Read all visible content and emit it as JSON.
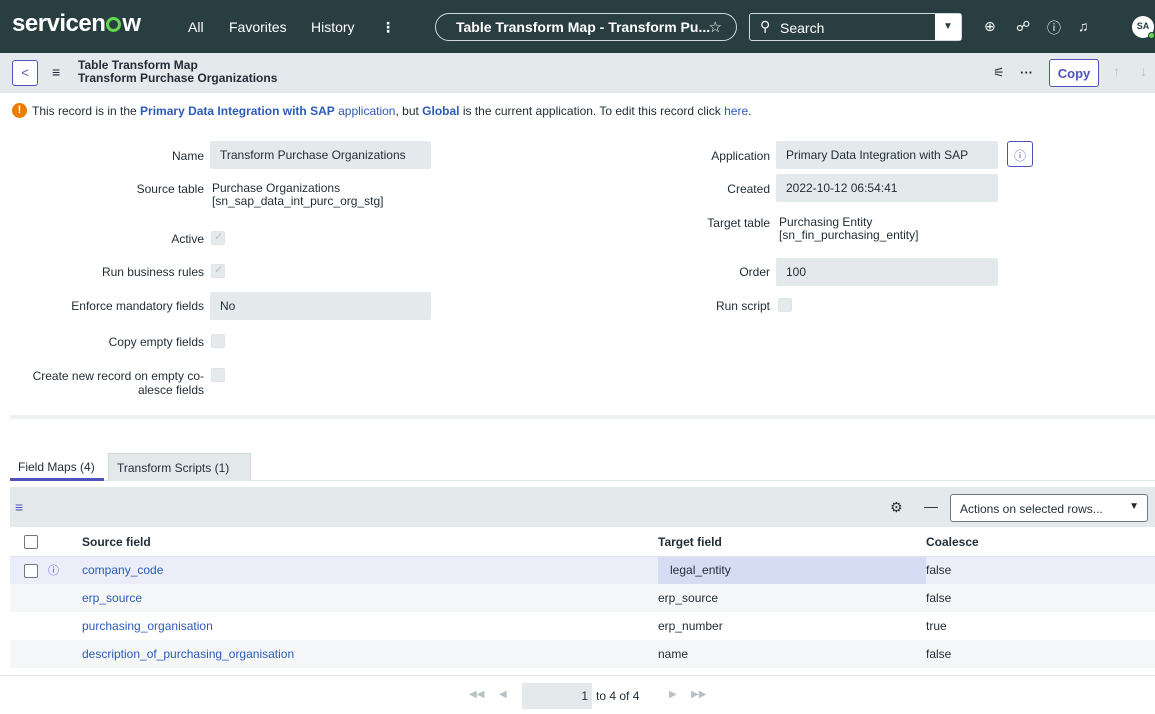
{
  "nav": {
    "logo_pre": "servicen",
    "logo_post": "w",
    "all": "All",
    "favorites": "Favorites",
    "history": "History",
    "more": "⋮",
    "context_pill": "Table Transform Map - Transform Pu...",
    "star": "☆",
    "search_placeholder": "Search",
    "avatar": "SA"
  },
  "header": {
    "line1": "Table Transform Map",
    "line2": "Transform Purchase Organizations",
    "copy": "Copy",
    "more": "···"
  },
  "notice": {
    "prefix": "This record is in the ",
    "scope_link": "Primary Data Integration with SAP",
    "scope_suffix": " application",
    "middle": ", but ",
    "global_link": "Global",
    "after": " is the current application. To edit this record click ",
    "here": "here",
    "end": "."
  },
  "form": {
    "name_label": "Name",
    "name_value": "Transform Purchase Organizations",
    "source_label": "Source table",
    "source_line1": "Purchase Organizations",
    "source_line2": "[sn_sap_data_int_purc_org_stg]",
    "active_label": "Active",
    "active_checked": true,
    "run_business_label": "Run business rules",
    "run_business_checked": true,
    "enforce_label": "Enforce mandatory fields",
    "enforce_value": "No",
    "copy_empty_label": "Copy empty fields",
    "create_new_line1": "Create new record on empty co-",
    "create_new_line2": "alesce fields",
    "application_label": "Application",
    "application_value": "Primary Data Integration with SAP",
    "created_label": "Created",
    "created_value": "2022-10-12 06:54:41",
    "target_label": "Target table",
    "target_line1": "Purchasing Entity",
    "target_line2": "[sn_fin_purchasing_entity]",
    "order_label": "Order",
    "order_value": "100",
    "run_script_label": "Run script"
  },
  "tabs": [
    {
      "label": "Field Maps (4)"
    },
    {
      "label": "Transform Scripts (1)"
    }
  ],
  "list": {
    "actions_select": "Actions on selected rows...",
    "columns": [
      "Source field",
      "Target field",
      "Coalesce"
    ],
    "rows": [
      {
        "source": "company_code",
        "target": "legal_entity",
        "coalesce": "false"
      },
      {
        "source": "erp_source",
        "target": "erp_source",
        "coalesce": "false"
      },
      {
        "source": "purchasing_organisation",
        "target": "erp_number",
        "coalesce": "true"
      },
      {
        "source": "description_of_purchasing_organisation",
        "target": "name",
        "coalesce": "false"
      }
    ]
  },
  "pager": {
    "current": "1",
    "range_text": "to 4 of 4"
  },
  "colors": {
    "nav_bg": "#293e40",
    "accent": "#4f52bd",
    "link": "#2c5bb9",
    "field_bg": "#e4e9eb",
    "warning": "#ea7d00"
  }
}
